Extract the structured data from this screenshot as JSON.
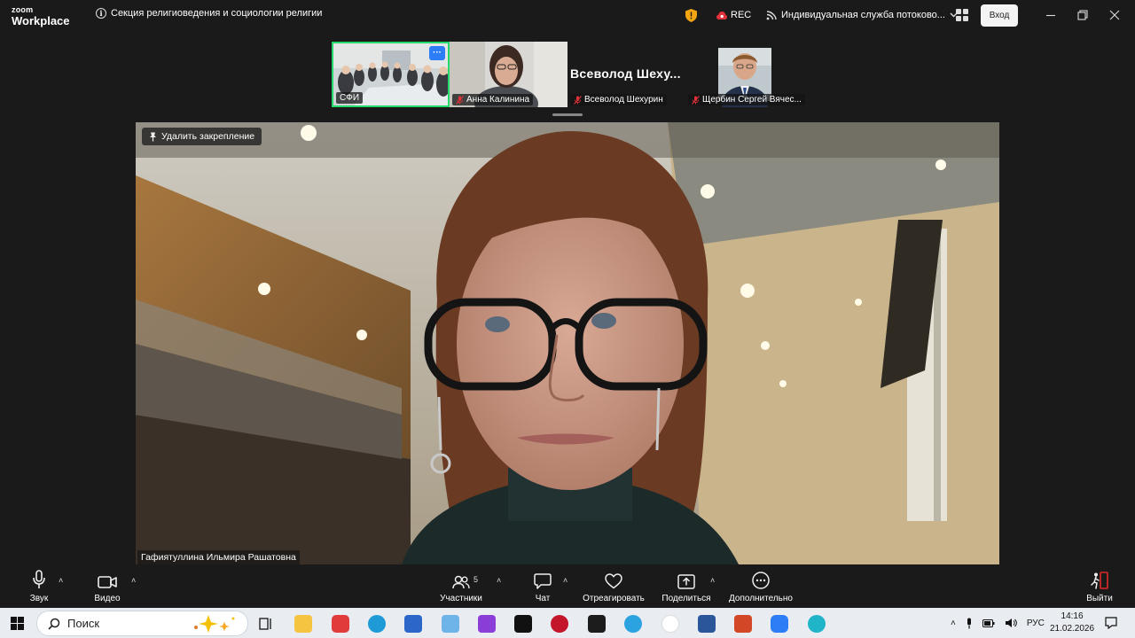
{
  "app": {
    "logo_line1": "zoom",
    "logo_line2": "Workplace"
  },
  "meeting": {
    "title": "Секция религиоведения и социологии религии"
  },
  "header": {
    "rec_label": "REC",
    "stream_label": "Индивидуальная служба потоково...",
    "signin_label": "Вход"
  },
  "thumbnails": [
    {
      "label": "СФИ",
      "more": "···"
    },
    {
      "label": "Анна Калинина"
    },
    {
      "label": "Всеволод Шехурин",
      "name_big": "Всеволод  Шеху..."
    },
    {
      "label": "Щербин Сергей Вячес..."
    }
  ],
  "main": {
    "unpin_label": "Удалить закрепление",
    "speaker_name": "Гафиятуллина Ильмира Рашатовна"
  },
  "toolbar": {
    "audio": "Звук",
    "video": "Видео",
    "participants": "Участники",
    "participants_count": "5",
    "chat": "Чат",
    "react": "Отреагировать",
    "share": "Поделиться",
    "more": "Дополнительно",
    "leave": "Выйти"
  },
  "taskbar": {
    "search_label": "Поиск",
    "lang": "РУС",
    "time": "14:16",
    "date": "21.02.2026"
  },
  "colors": {
    "accent": "#2d7df6",
    "active_border": "#23d96c",
    "leave": "#e02828",
    "mic_off": "#e0323a"
  }
}
